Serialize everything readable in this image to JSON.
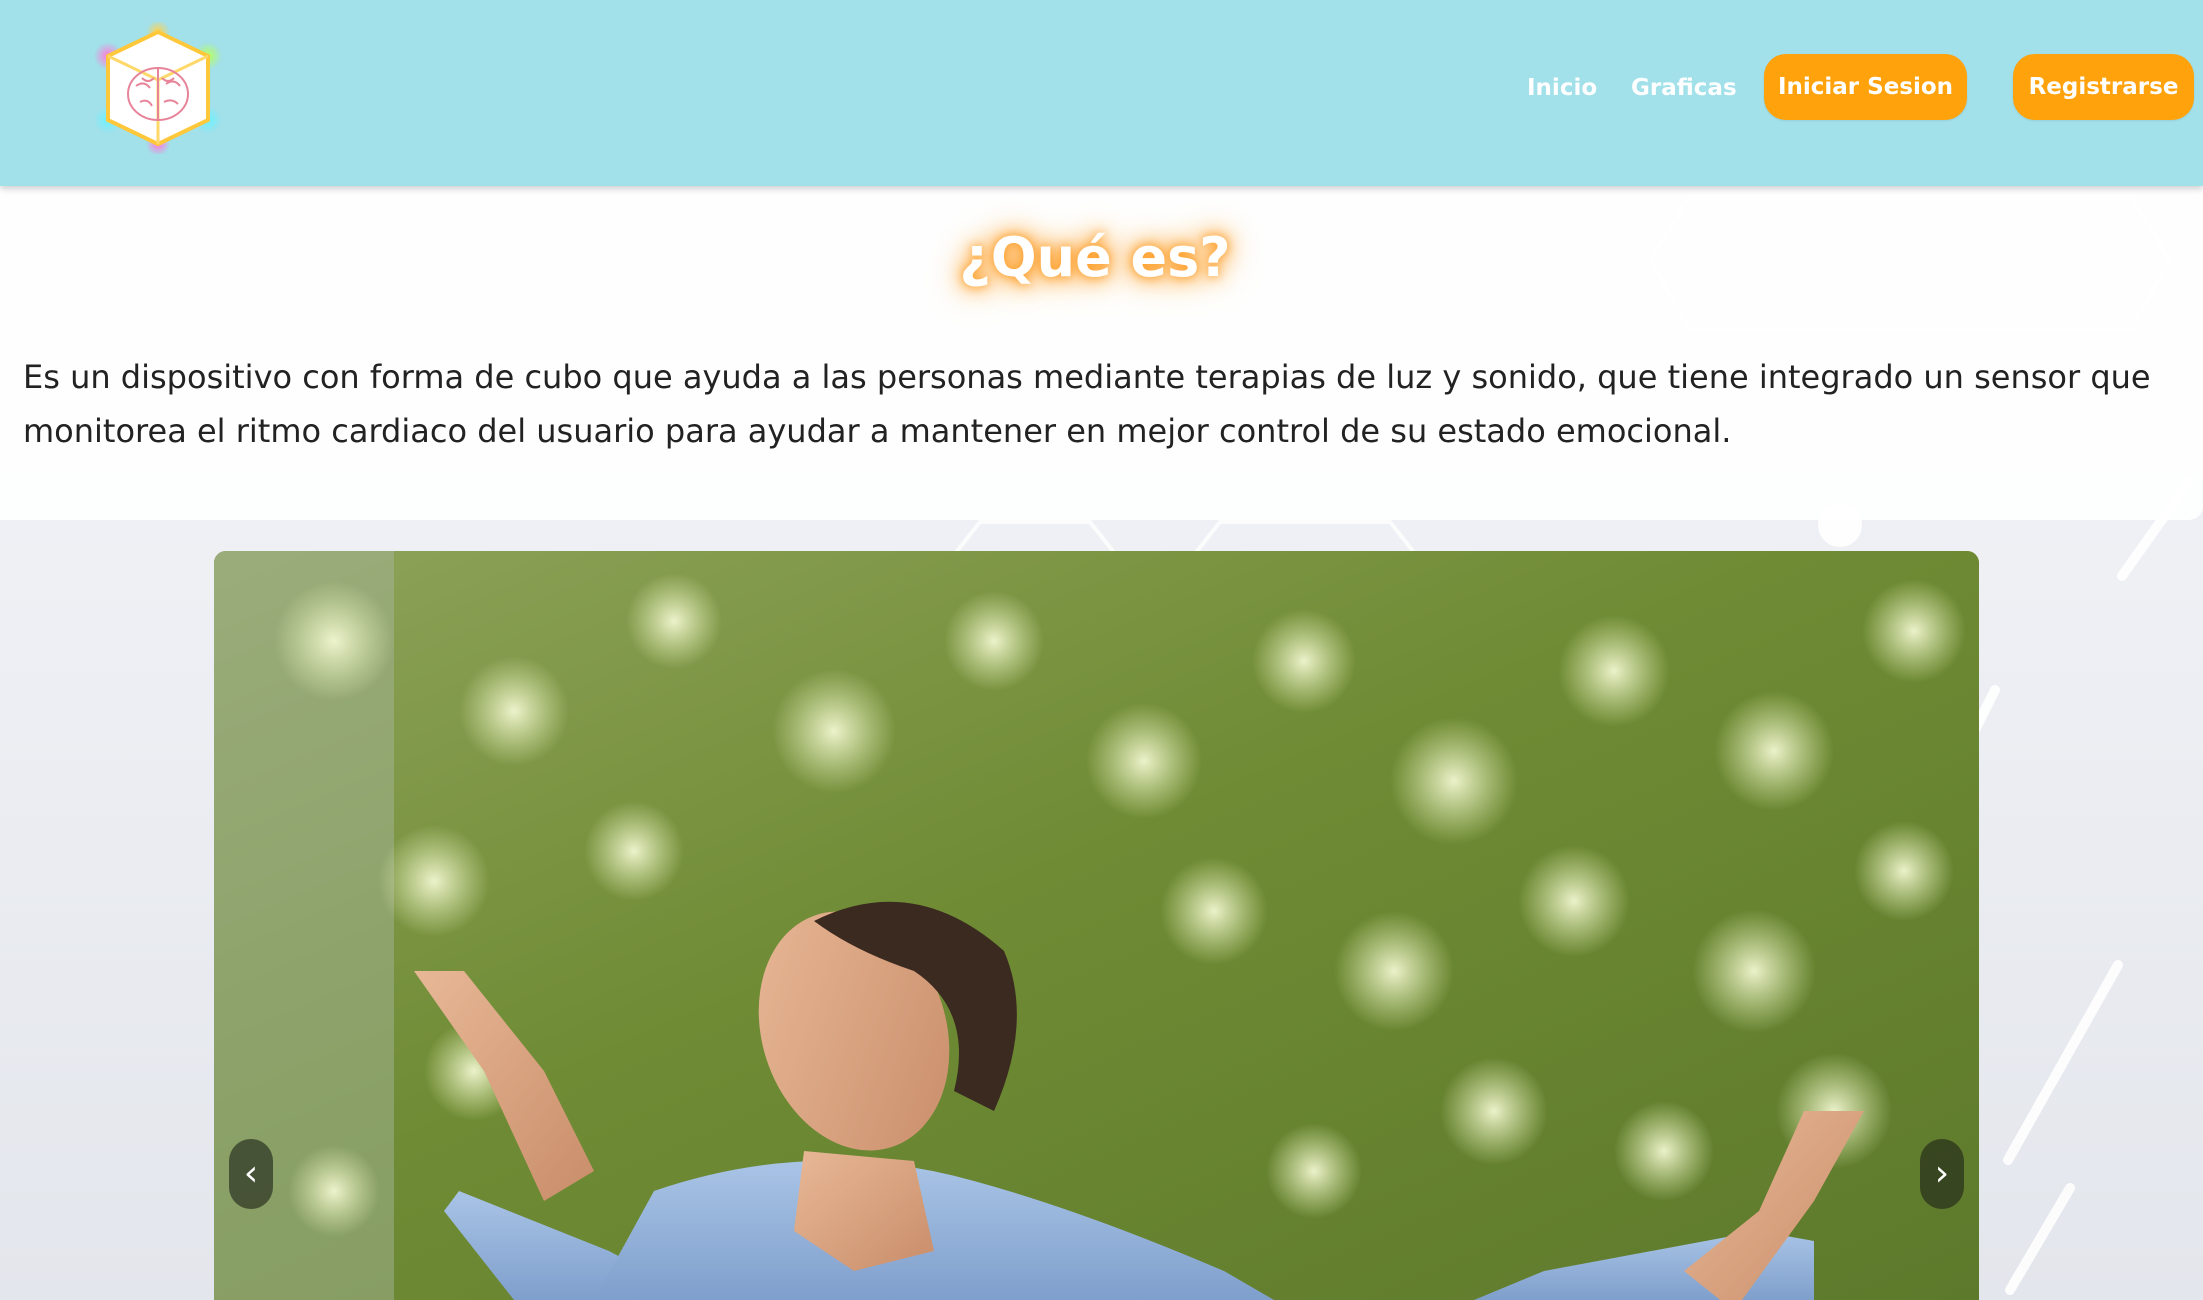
{
  "header": {
    "logo_icon": "brain-cube-logo-icon",
    "nav": {
      "inicio": "Inicio",
      "graficas": "Graficas"
    },
    "login_label": "Iniciar Sesion",
    "register_label": "Registrarse"
  },
  "about": {
    "title": "¿Qué es?",
    "description": "Es un dispositivo con forma de cubo que ayuda a las personas mediante terapias de luz y sonido, que tiene integrado un sensor que monitorea el ritmo cardiaco del usuario para ayudar a mantener en mejor control de su estado emocional."
  },
  "carousel": {
    "prev_arrow": "‹",
    "next_arrow": "›"
  },
  "colors": {
    "header_bg": "#a2e0ea",
    "accent": "#ffa20c",
    "title_glow": "#ff9a1f"
  }
}
